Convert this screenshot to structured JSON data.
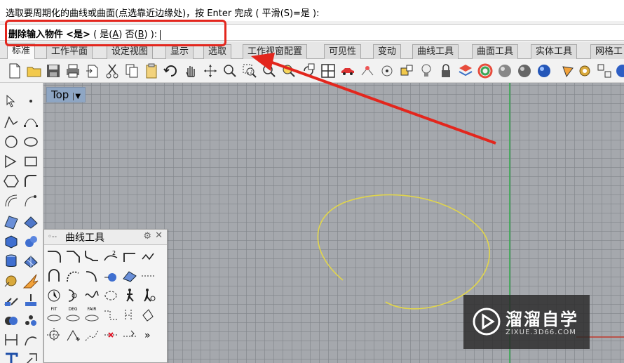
{
  "command": {
    "history_text": "选取要周期化的曲线或曲面(点选靠近边缘处)，按 Enter 完成 ( 平滑(S)=是 ):",
    "prompt_label": "删除输入物件",
    "prompt_default": "<是>",
    "prompt_open": "( 是(",
    "opt_yes_key": "A",
    "prompt_mid": ")  否(",
    "opt_no_key": "B",
    "prompt_close": ") ):"
  },
  "tabs": [
    {
      "label": "标准",
      "active": true
    },
    {
      "label": "工作平面"
    },
    {
      "label": "设定视图"
    },
    {
      "label": "显示"
    },
    {
      "label": "选取"
    },
    {
      "label": "工作视窗配置"
    },
    {
      "label": "可见性"
    },
    {
      "label": "变动"
    },
    {
      "label": "曲线工具"
    },
    {
      "label": "曲面工具"
    },
    {
      "label": "实体工具"
    },
    {
      "label": "网格工"
    }
  ],
  "viewport": {
    "label": "Top",
    "dropdown_glyph": "▼",
    "grid_color": "#a5a8ad",
    "curve_color": "#e2d64a",
    "y_axis_color": "#2fa84a",
    "x_axis_color": "#c0392b"
  },
  "curve_panel": {
    "title": "曲线工具",
    "grip": "◦--",
    "gear": "⚙",
    "close": "✕",
    "mini_labels": {
      "fit": "FIT",
      "deg": "DEG",
      "fair": "FAIR",
      "deg2": "2"
    },
    "more": "»"
  },
  "annotation": {
    "color": "#e3261d"
  },
  "watermark": {
    "title": "溜溜自学",
    "subtitle": "ZIXUE.3D66.COM"
  }
}
